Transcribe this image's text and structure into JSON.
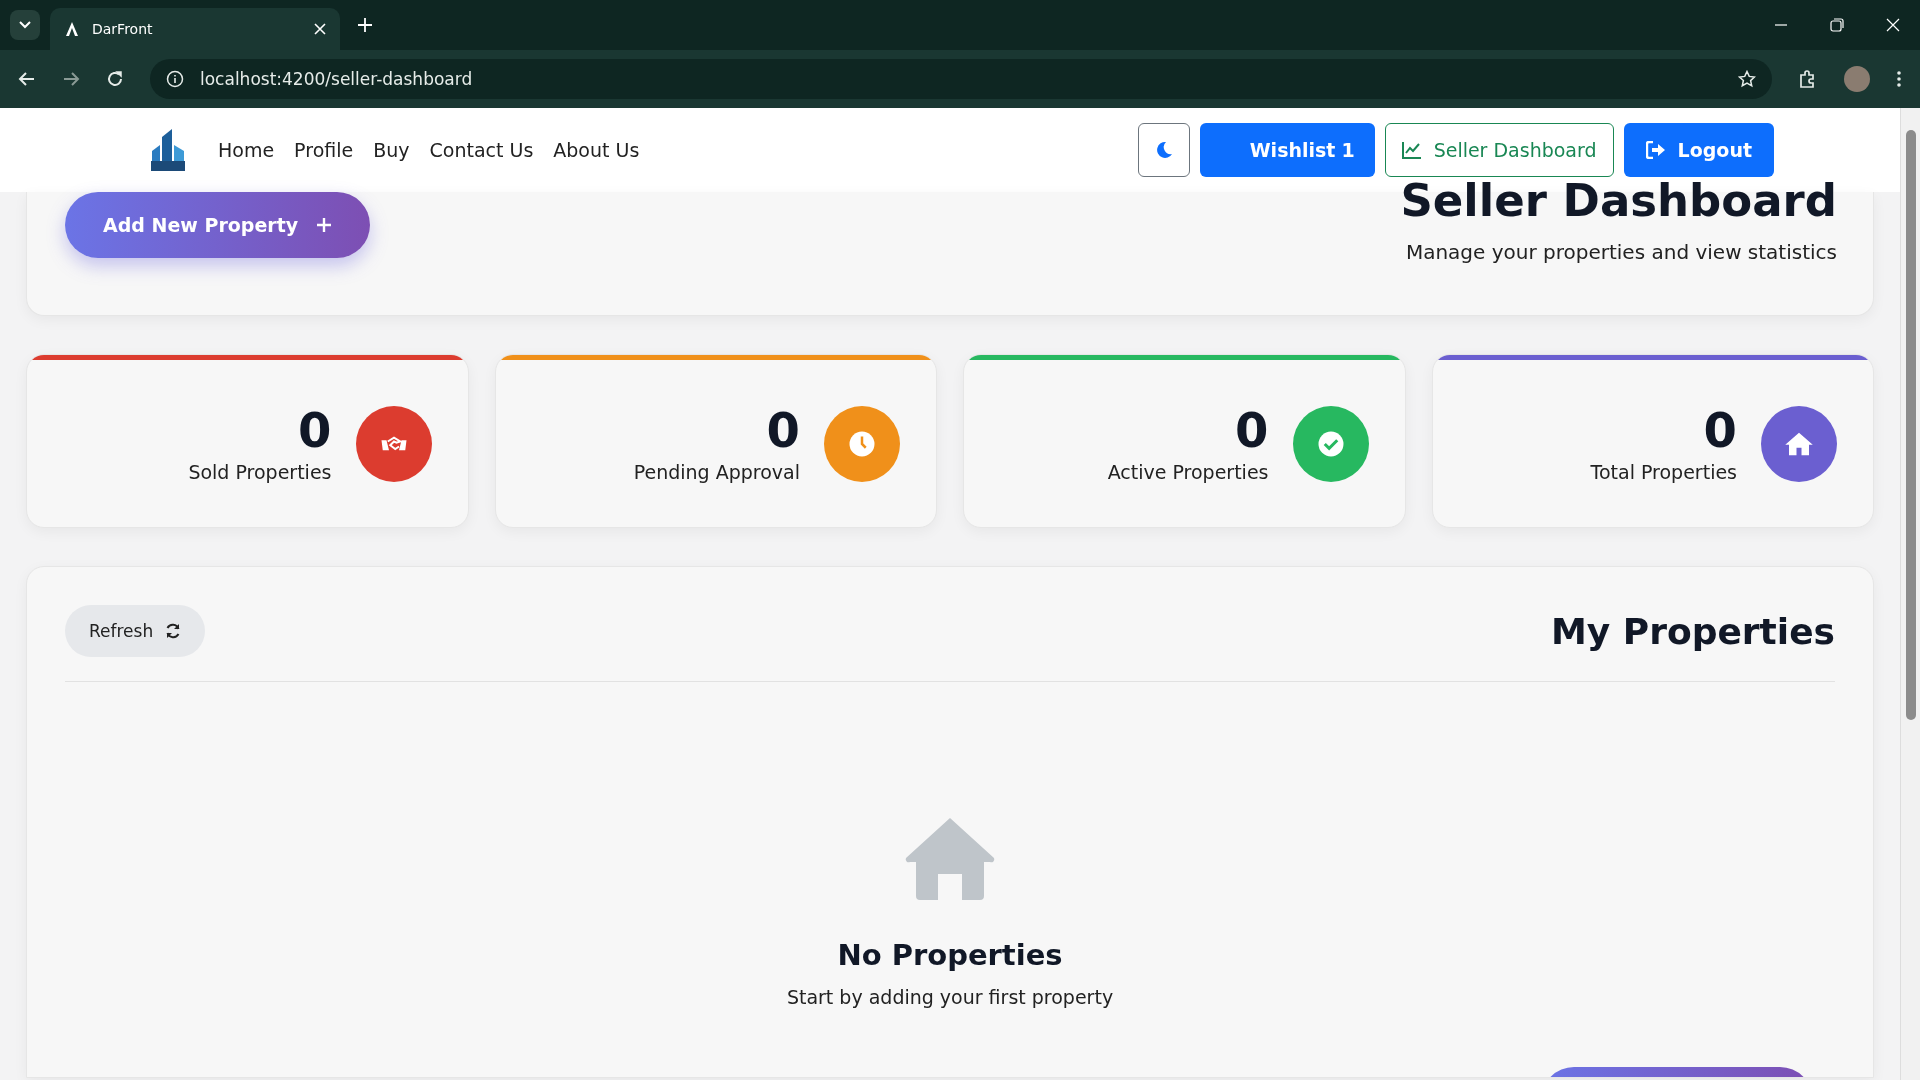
{
  "browser": {
    "tab_title": "DarFront",
    "url": "localhost:4200/seller-dashboard"
  },
  "nav": {
    "links": [
      {
        "label": "Home"
      },
      {
        "label": "Profile"
      },
      {
        "label": "Buy"
      },
      {
        "label": "Contact Us"
      },
      {
        "label": "About Us"
      }
    ],
    "wishlist": {
      "label": "Wishlist",
      "count": "1"
    },
    "dashboard_button": "Seller Dashboard",
    "logout_button": "Logout"
  },
  "header": {
    "add_button": "Add New Property",
    "title": "Seller Dashboard",
    "subtitle": "Manage your properties and view statistics"
  },
  "stats": [
    {
      "kind": "sold",
      "value": "0",
      "label": "Sold Properties",
      "color": "#dc3c2f"
    },
    {
      "kind": "pending",
      "value": "0",
      "label": "Pending Approval",
      "color": "#f0901a"
    },
    {
      "kind": "active",
      "value": "0",
      "label": "Active Properties",
      "color": "#27b860"
    },
    {
      "kind": "total",
      "value": "0",
      "label": "Total Properties",
      "color": "#6b5fd0"
    }
  ],
  "properties": {
    "refresh_button": "Refresh",
    "title": "My Properties",
    "empty_title": "No Properties",
    "empty_text": "Start by adding your first property"
  }
}
